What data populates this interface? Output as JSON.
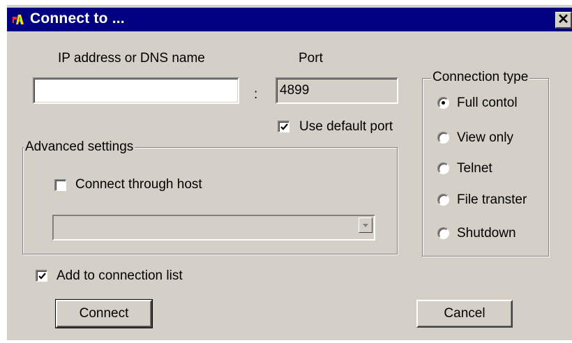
{
  "window": {
    "title": "Connect to ...",
    "close_label": "✕"
  },
  "address": {
    "label": "IP address or DNS name",
    "value": "",
    "separator": ":"
  },
  "port": {
    "label": "Port",
    "value": "4899"
  },
  "use_default_port": {
    "label": "Use default port",
    "checked": true
  },
  "advanced": {
    "title": "Advanced settings",
    "connect_through_host": {
      "label": "Connect through host",
      "checked": false
    },
    "host_select_value": ""
  },
  "connection_type": {
    "title": "Connection type",
    "selected": "Full contol",
    "options": [
      "Full contol",
      "View only",
      "Telnet",
      "File transter",
      "Shutdown"
    ]
  },
  "add_to_list": {
    "label": "Add to connection list",
    "checked": true
  },
  "buttons": {
    "connect": "Connect",
    "cancel": "Cancel"
  },
  "colors": {
    "titlebar": "#000080",
    "face": "#d4d0c8"
  }
}
